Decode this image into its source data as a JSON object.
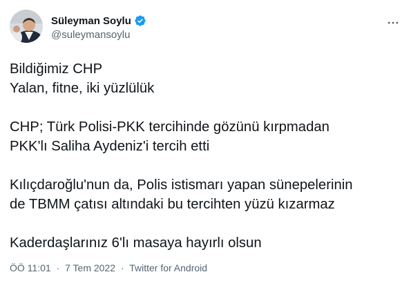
{
  "author": {
    "display_name": "Süleyman Soylu",
    "handle": "@suleymansoylu",
    "verified_color": "#1d9bf0"
  },
  "more_icon": "more-horizontal-icon",
  "tweet": {
    "lines": {
      "l1": "Bildiğimiz CHP",
      "l2": "Yalan, fitne, iki yüzlülük",
      "l3": "CHP; Türk Polisi-PKK tercihinde gözünü kırpmadan",
      "l4": "PKK'lı Saliha Aydeniz'i tercih etti",
      "l5": "Kılıçdaroğlu'nun da, Polis istismarı yapan sünepelerinin",
      "l6": "de TBMM çatısı altındaki bu tercihten yüzü kızarmaz",
      "l7": "Kaderdaşlarınız 6'lı masaya hayırlı olsun"
    }
  },
  "meta": {
    "time": "ÖÖ 11:01",
    "separator": "·",
    "date": "7 Tem 2022",
    "source": "Twitter for Android"
  },
  "colors": {
    "text": "#0f1419",
    "secondary": "#536471",
    "accent": "#1d9bf0"
  }
}
